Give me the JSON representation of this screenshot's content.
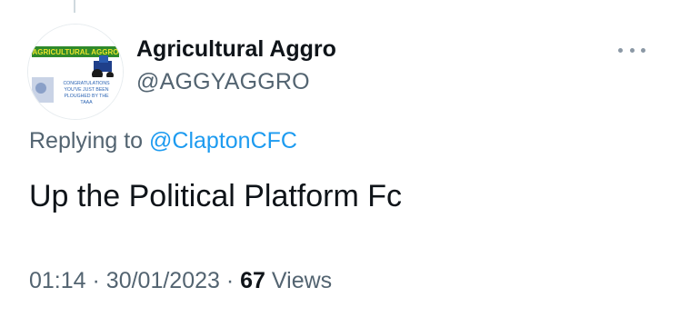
{
  "tweet": {
    "display_name": "Agricultural Aggro",
    "handle": "@AGGYAGGRO",
    "replying_prefix": "Replying to",
    "replying_to": "@ClaptonCFC",
    "text": "Up the Political Platform Fc",
    "time": "01:14",
    "separator": "·",
    "date": "30/01/2023",
    "view_count": "67",
    "views_label": "Views"
  },
  "avatar": {
    "banner_text": "AGRICULTURAL AGGRO",
    "caption_lines": [
      "CONGRATULATIONS",
      "YOU'VE JUST BEEN",
      "PLOUGHED BY THE",
      "TAAA"
    ]
  },
  "icons": {
    "more": "more-options-icon",
    "tractor": "tractor-icon"
  },
  "colors": {
    "text_primary": "#0f1419",
    "text_secondary": "#536471",
    "link": "#1d9bf0",
    "banner_green": "#2f8a2a",
    "banner_yellow": "#e9e32c",
    "caption_blue": "#2a63b3"
  }
}
